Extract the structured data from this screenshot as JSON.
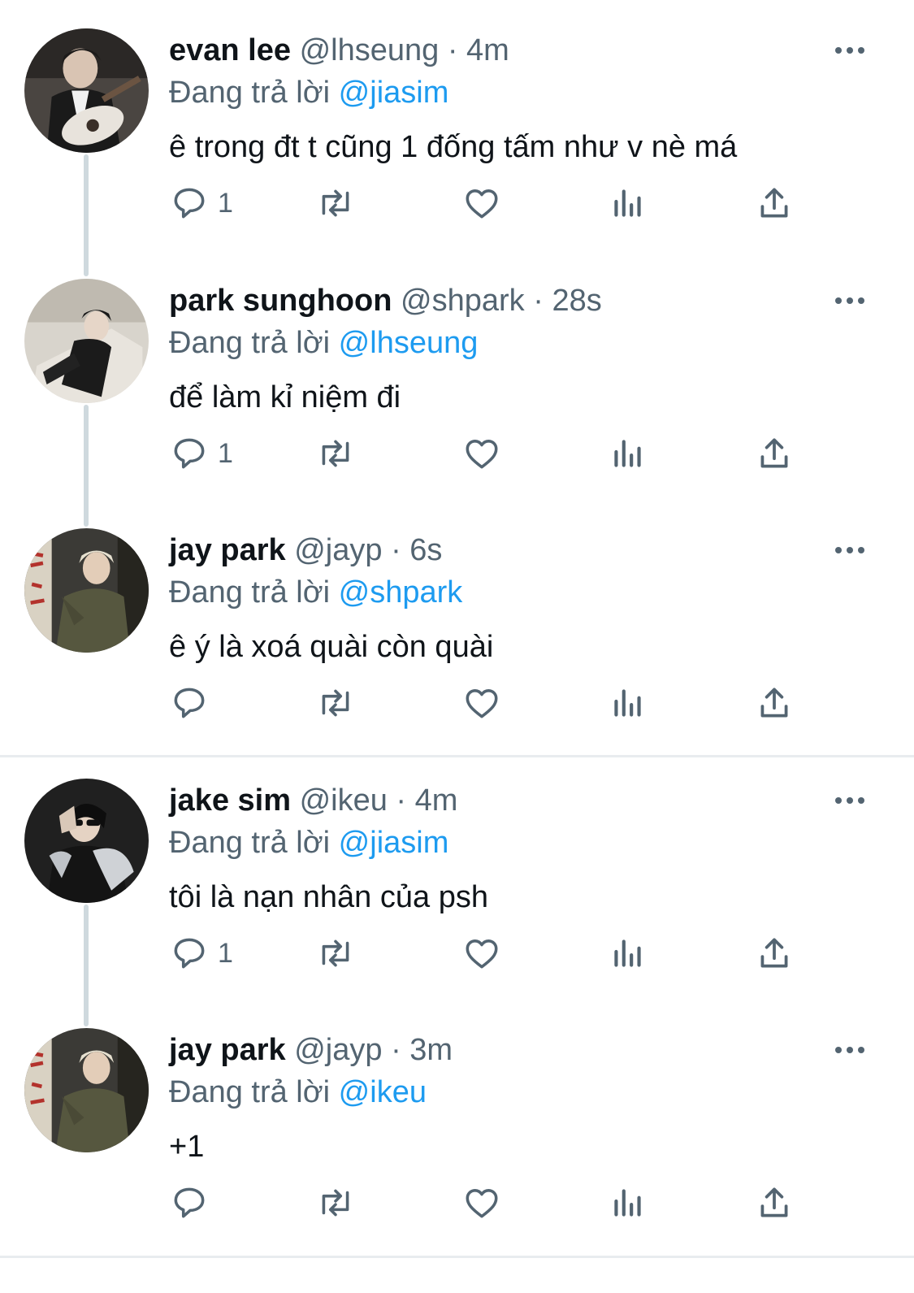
{
  "reply_prefix": "Đang trả lời",
  "tweets": [
    {
      "name": "evan lee",
      "handle": "@lhseung",
      "dot": "·",
      "time": "4m",
      "reply_to": "@jiasim",
      "text": "ê trong đt t cũng 1 đống tấm như v nè má",
      "reply_count": "1"
    },
    {
      "name": "park sunghoon",
      "handle": "@shpark",
      "dot": "·",
      "time": "28s",
      "reply_to": "@lhseung",
      "text": "để làm kỉ niệm đi",
      "reply_count": "1"
    },
    {
      "name": "jay park",
      "handle": "@jayp",
      "dot": "·",
      "time": "6s",
      "reply_to": "@shpark",
      "text": "ê ý là xoá quài còn quài",
      "reply_count": ""
    },
    {
      "name": "jake sim",
      "handle": "@ikeu",
      "dot": "·",
      "time": "4m",
      "reply_to": "@jiasim",
      "text": "tôi là nạn nhân của psh",
      "reply_count": "1"
    },
    {
      "name": "jay park",
      "handle": "@jayp",
      "dot": "·",
      "time": "3m",
      "reply_to": "@ikeu",
      "text": "+1",
      "reply_count": ""
    }
  ],
  "colors": {
    "text": "#0f1419",
    "secondary": "#536471",
    "mention": "#1d9bf0",
    "thread_line": "#cfd9de",
    "separator": "#e8ecef"
  },
  "icons": [
    "reply-icon",
    "retweet-icon",
    "like-icon",
    "views-icon",
    "share-icon",
    "more-icon"
  ]
}
